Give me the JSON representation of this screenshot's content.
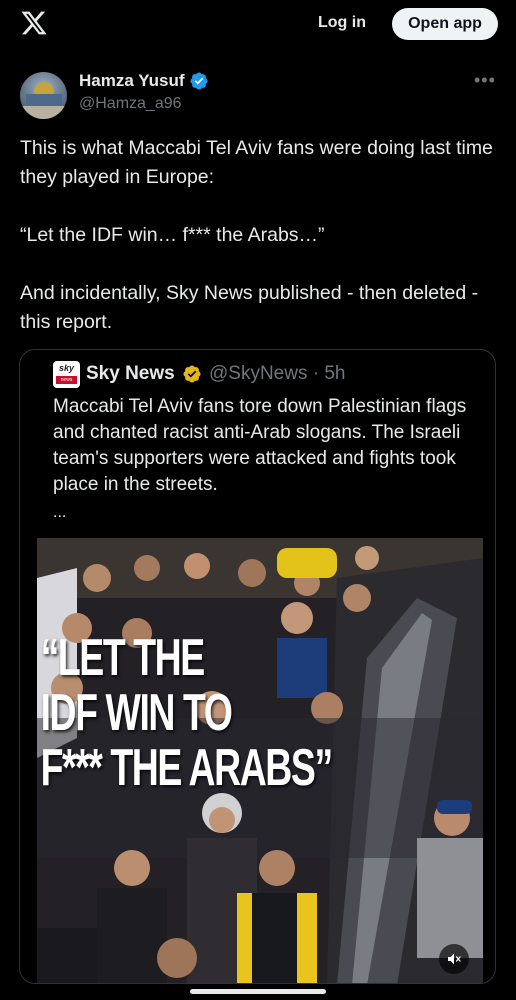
{
  "header": {
    "login_label": "Log in",
    "open_app_label": "Open app"
  },
  "tweet": {
    "author_name": "Hamza Yusuf",
    "author_handle": "@Hamza_a96",
    "more_label": "•••",
    "text": "This is what Maccabi Tel Aviv fans were doing last time they played in Europe:\n\n“Let the IDF win… f*** the Arabs…”\n\nAnd incidentally, Sky News published - then deleted - this report."
  },
  "quoted_tweet": {
    "author_name": "Sky News",
    "author_handle": "@SkyNews · 5h",
    "text": "Maccabi Tel Aviv fans tore down Palestinian flags and chanted racist anti-Arab slogans. The Israeli team's supporters were attacked and fights took place in the streets.",
    "ellipsis": "...",
    "logo_text_top": "sky",
    "logo_text_bottom": "news",
    "media": {
      "overlay_text": "“LET THE\nIDF WIN TO\nF*** THE ARABS”"
    }
  },
  "colors": {
    "background": "#000000",
    "text_primary": "#e7e9ea",
    "text_secondary": "#71767b",
    "verified_blue": "#1d9bf0",
    "verified_gold": "#e2b719",
    "border": "#2f3336"
  },
  "icons": {
    "logo": "x-logo-icon",
    "verified": "verified-badge-icon",
    "mute": "speaker-muted-icon"
  }
}
